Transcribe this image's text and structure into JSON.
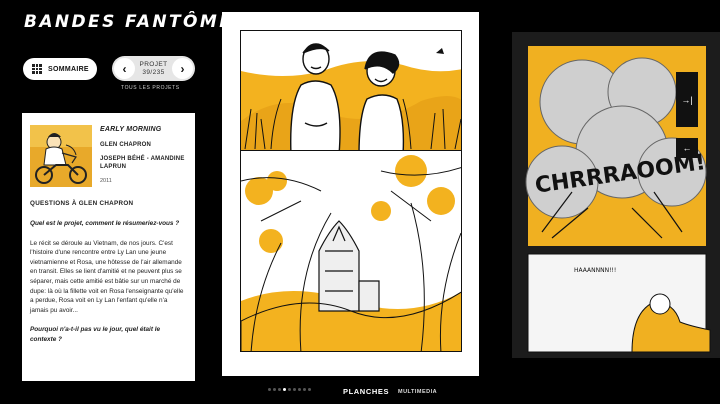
{
  "header": {
    "site_title": "BANDES FANTÔMES"
  },
  "toolbar": {
    "sommaire_label": "SOMMAIRE",
    "projet_label": "PROJET",
    "projet_counter": "39/235",
    "all_projects_link": "TOUS LES PROJETS"
  },
  "project": {
    "title": "EARLY MORNING",
    "author": "GLEN CHAPRON",
    "collaborators": "JOSEPH BÉHÉ - AMANDINE LAPRUN",
    "year": "2011"
  },
  "interview": {
    "heading": "QUESTIONS À GLEN CHAPRON",
    "question1": "Quel est le projet, comment le résumeriez-vous ?",
    "answer1_p1": "Le récit se déroule au Vietnam, de nos jours. C'est l'histoire d'une rencontre entre Ly Lan une jeune vietnamienne et Rosa, une hôtesse de l'air allemande en transit. Elles se lient d'amitié et ne peuvent plus se séparer, mais cette amitié est bâtie sur un marché de dupe: là où la fillette voit en Rosa l'enseignante qu'elle a perdue, Rosa voit en Ly Lan l'enfant qu'elle n'a jamais pu avoir...",
    "question2": "Pourquoi n'a-t-il pas vu le jour, quel était le contexte ?"
  },
  "comic": {
    "right_page_sfx": "CHRRRAOOM!",
    "right_page_speech": "HAAANNNN!!!"
  },
  "bottom_nav": {
    "tab_planches": "PLANCHES",
    "tab_multimedia": "MULTIMEDIA",
    "page_dots": 9,
    "active_dot": 3
  },
  "icons": {
    "sommaire": "grid-icon",
    "prev": "chevron-left-icon",
    "next": "chevron-right-icon",
    "expand": "arrow-expand-icon",
    "back": "arrow-back-icon"
  },
  "colors": {
    "accent_ochre": "#f3b21f",
    "background": "#000000",
    "panel": "#ffffff"
  }
}
